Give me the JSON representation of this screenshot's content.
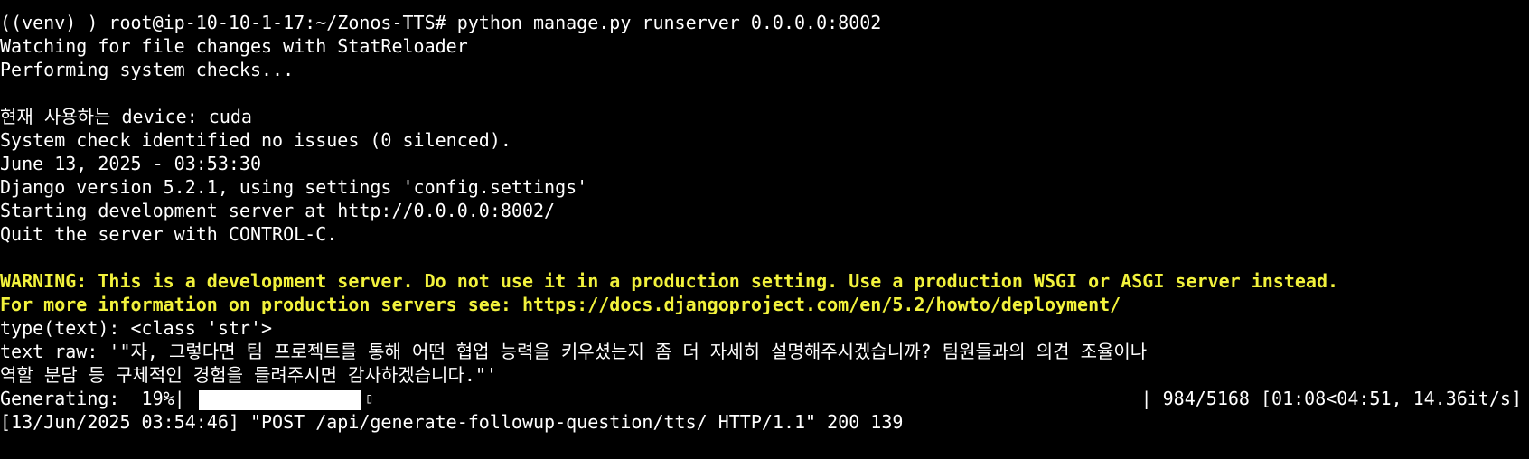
{
  "terminal": {
    "partial_top_line": "  ,       .  [  ]  [  ]",
    "lines": [
      "((venv) ) root@ip-10-10-1-17:~/Zonos-TTS# python manage.py runserver 0.0.0.0:8002",
      "Watching for file changes with StatReloader",
      "Performing system checks...",
      "",
      "현재 사용하는 device: cuda",
      "System check identified no issues (0 silenced).",
      "June 13, 2025 - 03:53:30",
      "Django version 5.2.1, using settings 'config.settings'",
      "Starting development server at http://0.0.0.0:8002/",
      "Quit the server with CONTROL-C.",
      ""
    ],
    "warning_lines": [
      "WARNING: This is a development server. Do not use it in a production setting. Use a production WSGI or ASGI server instead.",
      "For more information on production servers see: https://docs.djangoproject.com/en/5.2/howto/deployment/"
    ],
    "after_lines": [
      "type(text): <class 'str'>",
      "text raw: '\"자, 그렇다면 팀 프로젝트를 통해 어떤 협업 능력을 키우셨는지 좀 더 자세히 설명해주시겠습니까? 팀원들과의 의견 조율이나",
      "역할 분담 등 구체적인 경험을 들려주시면 감사하겠습니다.\"'"
    ],
    "progress": {
      "label": "Generating:  19%|",
      "glyph": "▯",
      "stats": "| 984/5168 [01:08<04:51, 14.36it/s]",
      "fraction": 0.19
    },
    "final_line": "[13/Jun/2025 03:54:46] \"POST /api/generate-followup-question/tts/ HTTP/1.1\" 200 139"
  },
  "colors": {
    "background": "#000000",
    "text": "#ffffff",
    "warning": "#f2f23c"
  }
}
